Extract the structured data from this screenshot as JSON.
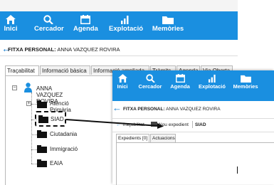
{
  "nav": {
    "items": [
      {
        "label": "Inici",
        "icon": "home-icon"
      },
      {
        "label": "Cercador",
        "icon": "search-icon"
      },
      {
        "label": "Agenda",
        "icon": "calendar-icon"
      },
      {
        "label": "Explotació",
        "icon": "bar-chart-icon"
      },
      {
        "label": "Memòries",
        "icon": "folder-icon"
      }
    ],
    "color": "#1a8fe0"
  },
  "window1": {
    "back_icon": "arrow-left-icon",
    "fitxa_label": "FITXA PERSONAL:",
    "person_name": "ANNA VAZQUEZ ROVIRA",
    "tabs": [
      "Traçabilitat",
      "Informació bàsica",
      "Informació ampliada",
      "Tràmits",
      "Agenda",
      "Via Oberta"
    ],
    "active_tab": "Traçabilitat",
    "tree": {
      "root": {
        "label": "ANNA VAZQUEZ ROVIRA",
        "icon": "person-icon"
      },
      "children": [
        {
          "label": "Atenció Primària",
          "expander": "+"
        },
        {
          "label": "SIAD",
          "highlighted": true
        },
        {
          "label": "Ciutadania"
        },
        {
          "label": "Immigració"
        },
        {
          "label": "EAIA"
        }
      ]
    }
  },
  "window2": {
    "fitxa_label": "FITXA PERSONAL:",
    "person_name": "ANNA VAZQUEZ ROVIRA",
    "back_label": "Traçabilitat",
    "nou_expedient": "Nou expedient",
    "current": "SIAD",
    "tabs": [
      "Expedients [0]",
      "Actuacions"
    ]
  },
  "accent_color": "#1a8fe0"
}
